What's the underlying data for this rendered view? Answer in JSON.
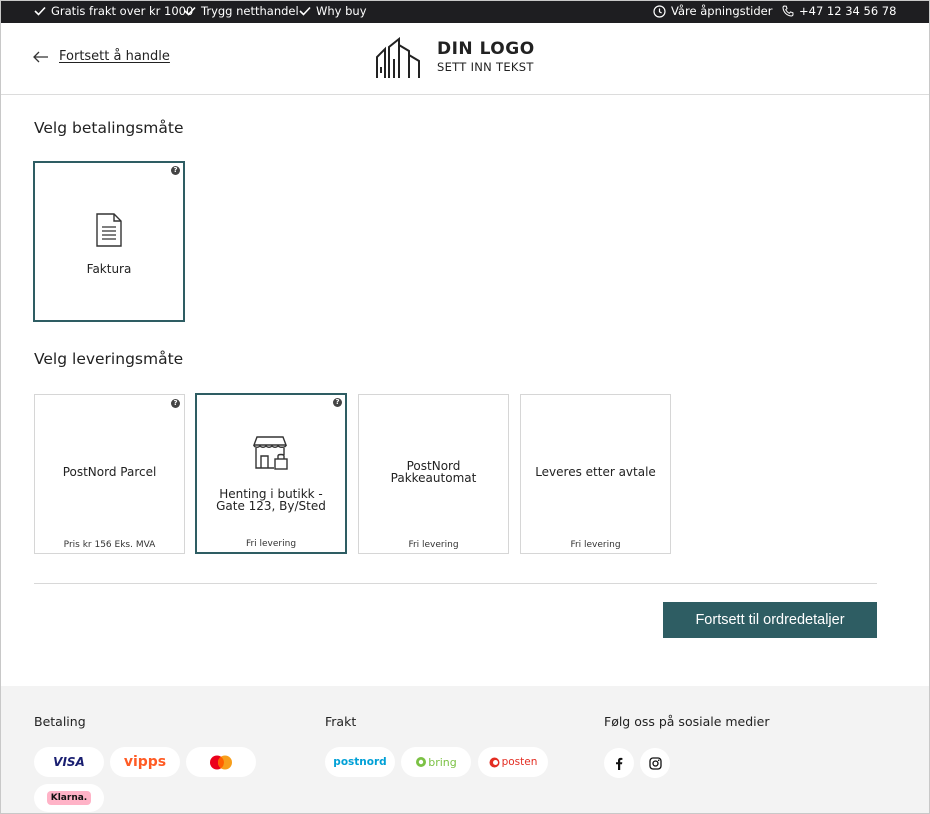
{
  "topbar": {
    "free_shipping": "Gratis frakt over kr 1000",
    "secure": "Trygg netthandel",
    "why_buy": "Why buy",
    "opening_hours": "Våre åpningstider",
    "phone": "+47 12 34 56 78"
  },
  "header": {
    "back_label": "Fortsett å handle",
    "logo_title": "DIN LOGO",
    "logo_subtitle": "SETT INN TEKST"
  },
  "payment": {
    "heading": "Velg betalingsmåte",
    "options": [
      {
        "label": "Faktura",
        "icon": "invoice-icon",
        "selected": true
      }
    ]
  },
  "delivery": {
    "heading": "Velg leveringsmåte",
    "options": [
      {
        "label": "PostNord Parcel",
        "price": "Pris kr 156 Eks. MVA",
        "selected": false,
        "help": true
      },
      {
        "label": "Henting i butikk - Gate 123, By/Sted",
        "price": "Fri levering",
        "selected": true,
        "help": true,
        "icon": "store-icon"
      },
      {
        "label": "PostNord Pakkeautomat",
        "price": "Fri levering",
        "selected": false,
        "help": false
      },
      {
        "label": "Leveres etter avtale",
        "price": "Fri levering",
        "selected": false,
        "help": false
      }
    ]
  },
  "cta": {
    "label": "Fortsett til ordredetaljer"
  },
  "footer": {
    "payment_title": "Betaling",
    "shipping_title": "Frakt",
    "social_title": "Følg oss på sosiale medier",
    "payment_logos": [
      "VISA",
      "vipps",
      "mastercard",
      "Klarna."
    ],
    "shipping_logos": [
      "postnord",
      "bring",
      "posten"
    ],
    "social": [
      "facebook-icon",
      "instagram-icon"
    ]
  },
  "colors": {
    "accent": "#2e5d63",
    "topbar": "#1e1e21",
    "footer_bg": "#f3f3f3"
  }
}
